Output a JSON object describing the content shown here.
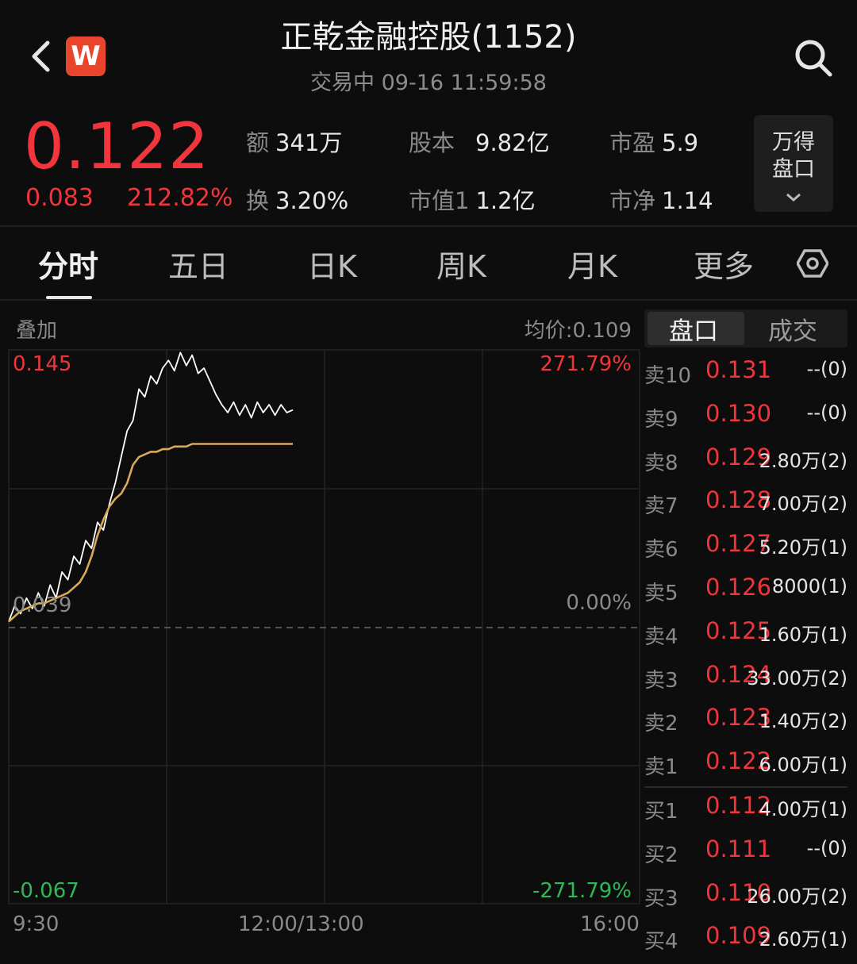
{
  "header": {
    "title": "正乾金融控股(1152)",
    "subtitle": "交易中  09-16 11:59:58",
    "logo_letter": "W"
  },
  "quote": {
    "price": "0.122",
    "change": "0.083",
    "change_pct": "212.82%",
    "stats": [
      {
        "key": "额",
        "value": "341万"
      },
      {
        "key": "股本",
        "value": "9.82亿"
      },
      {
        "key": "市盈",
        "value": "5.9"
      },
      {
        "key": "换",
        "value": "3.20%"
      },
      {
        "key": "市值1",
        "value": "1.2亿"
      },
      {
        "key": "市净",
        "value": "1.14"
      }
    ],
    "wind_button": [
      "万得",
      "盘口"
    ]
  },
  "tabs": [
    "分时",
    "五日",
    "日K",
    "周K",
    "月K",
    "更多"
  ],
  "active_tab": "分时",
  "chart": {
    "overlay_label": "叠加",
    "avg_price_label": "均价:0.109",
    "y_top": "0.145",
    "y_mid": "0.039",
    "y_bottom": "-0.067",
    "pct_top": "271.79%",
    "pct_mid": "0.00%",
    "pct_bottom": "-271.79%",
    "x_labels": [
      "9:30",
      "12:00/13:00",
      "16:00"
    ],
    "colors": {
      "price_line": "#ffffff",
      "avg_line": "#d9a95a",
      "up": "#f0363c",
      "down": "#2fb85a"
    }
  },
  "chart_data": {
    "type": "line",
    "series": [
      {
        "values": [
          0.041,
          0.047,
          0.044,
          0.05,
          0.046,
          0.052,
          0.047,
          0.055,
          0.05,
          0.06,
          0.057,
          0.066,
          0.063,
          0.072,
          0.069,
          0.079,
          0.076,
          0.086,
          0.094,
          0.104,
          0.114,
          0.118,
          0.13,
          0.127,
          0.135,
          0.132,
          0.138,
          0.141,
          0.137,
          0.144,
          0.139,
          0.143,
          0.136,
          0.138,
          0.133,
          0.128,
          0.124,
          0.121,
          0.125,
          0.12,
          0.124,
          0.119,
          0.125,
          0.121,
          0.124,
          0.12,
          0.124,
          0.121,
          0.122
        ]
      },
      {
        "values": [
          0.041,
          0.043,
          0.045,
          0.046,
          0.047,
          0.048,
          0.048,
          0.049,
          0.05,
          0.051,
          0.052,
          0.054,
          0.056,
          0.06,
          0.066,
          0.074,
          0.08,
          0.085,
          0.088,
          0.09,
          0.094,
          0.101,
          0.104,
          0.105,
          0.106,
          0.106,
          0.107,
          0.107,
          0.108,
          0.108,
          0.108,
          0.109,
          0.109,
          0.109,
          0.109,
          0.109,
          0.109,
          0.109,
          0.109,
          0.109,
          0.109,
          0.109,
          0.109,
          0.109,
          0.109,
          0.109,
          0.109,
          0.109,
          0.109
        ]
      }
    ],
    "ylim": [
      -0.067,
      0.145
    ],
    "x_ticks": [
      "9:30",
      "12:00/13:00",
      "16:00"
    ]
  },
  "order_book": {
    "tabs": [
      "盘口",
      "成交"
    ],
    "asks": [
      {
        "level": "卖10",
        "price": "0.131",
        "volume": "--(0)"
      },
      {
        "level": "卖9",
        "price": "0.130",
        "volume": "--(0)"
      },
      {
        "level": "卖8",
        "price": "0.129",
        "volume": "2.80万(2)"
      },
      {
        "level": "卖7",
        "price": "0.128",
        "volume": "7.00万(2)"
      },
      {
        "level": "卖6",
        "price": "0.127",
        "volume": "5.20万(1)"
      },
      {
        "level": "卖5",
        "price": "0.126",
        "volume": "8000(1)"
      },
      {
        "level": "卖4",
        "price": "0.125",
        "volume": "1.60万(1)"
      },
      {
        "level": "卖3",
        "price": "0.124",
        "volume": "33.00万(2)"
      },
      {
        "level": "卖2",
        "price": "0.123",
        "volume": "1.40万(2)"
      },
      {
        "level": "卖1",
        "price": "0.122",
        "volume": "6.00万(1)"
      }
    ],
    "bids": [
      {
        "level": "买1",
        "price": "0.112",
        "volume": "4.00万(1)"
      },
      {
        "level": "买2",
        "price": "0.111",
        "volume": "--(0)"
      },
      {
        "level": "买3",
        "price": "0.110",
        "volume": "26.00万(2)"
      },
      {
        "level": "买4",
        "price": "0.109",
        "volume": "2.60万(1)"
      }
    ]
  }
}
